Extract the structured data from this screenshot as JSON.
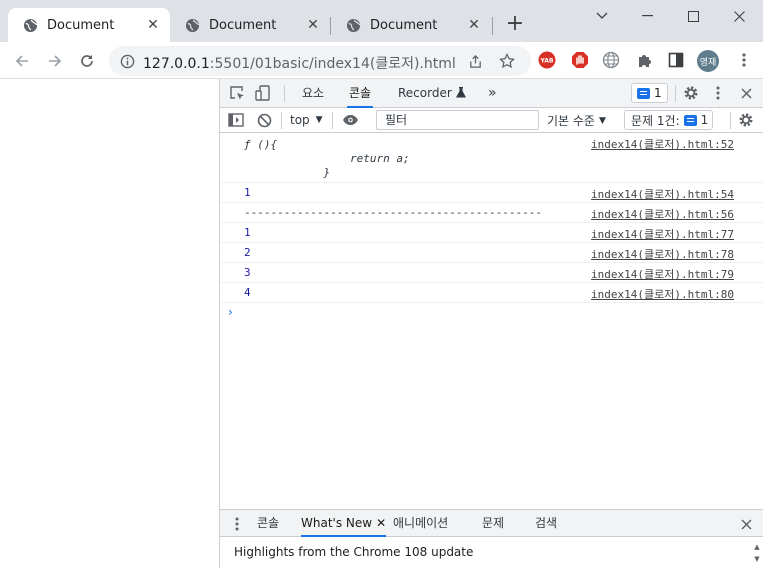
{
  "tabs": [
    {
      "title": "Document",
      "active": true
    },
    {
      "title": "Document",
      "active": false
    },
    {
      "title": "Document",
      "active": false
    }
  ],
  "window": {
    "minimize_icon": "chevron-down-icon",
    "minimize2_icon": "minimize-icon",
    "maximize_icon": "maximize-icon",
    "close_icon": "close-icon"
  },
  "omnibox": {
    "host": "127.0.0.1",
    "path": ":5501/01basic/index14(클로저).html"
  },
  "extensions": {
    "yab_label": "YAB"
  },
  "profile": {
    "initials": "영재"
  },
  "devtools": {
    "tabs": [
      "요소",
      "콘솔",
      "Recorder"
    ],
    "active_tab": "콘솔",
    "issues_count": "1",
    "context": "top",
    "filter_placeholder": "필터",
    "level": "기본 수준",
    "issues_label": "문제 1건:",
    "issues_badge_count": "1",
    "console": {
      "function_source": "index14(클로저).html:52",
      "function_lines": [
        "ƒ (){",
        "                return a;",
        "            }"
      ],
      "messages": [
        {
          "text": "1",
          "source": "index14(클로저).html:54"
        },
        {
          "text": "---------------------------------------------",
          "source": "index14(클로저).html:56"
        },
        {
          "text": "1",
          "source": "index14(클로저).html:77"
        },
        {
          "text": "2",
          "source": "index14(클로저).html:78"
        },
        {
          "text": "3",
          "source": "index14(클로저).html:79"
        },
        {
          "text": "4",
          "source": "index14(클로저).html:80"
        }
      ],
      "prompt": "›"
    },
    "drawer": {
      "tabs": [
        "콘솔",
        "What's New",
        "애니메이션",
        "문제",
        "검색"
      ],
      "active_tab": "What's New",
      "body": "Highlights from the Chrome 108 update"
    }
  },
  "colors": {
    "accent": "#1a73e8",
    "tab_strip": "#dee1e6",
    "panel_bg": "#f1f3f4"
  }
}
